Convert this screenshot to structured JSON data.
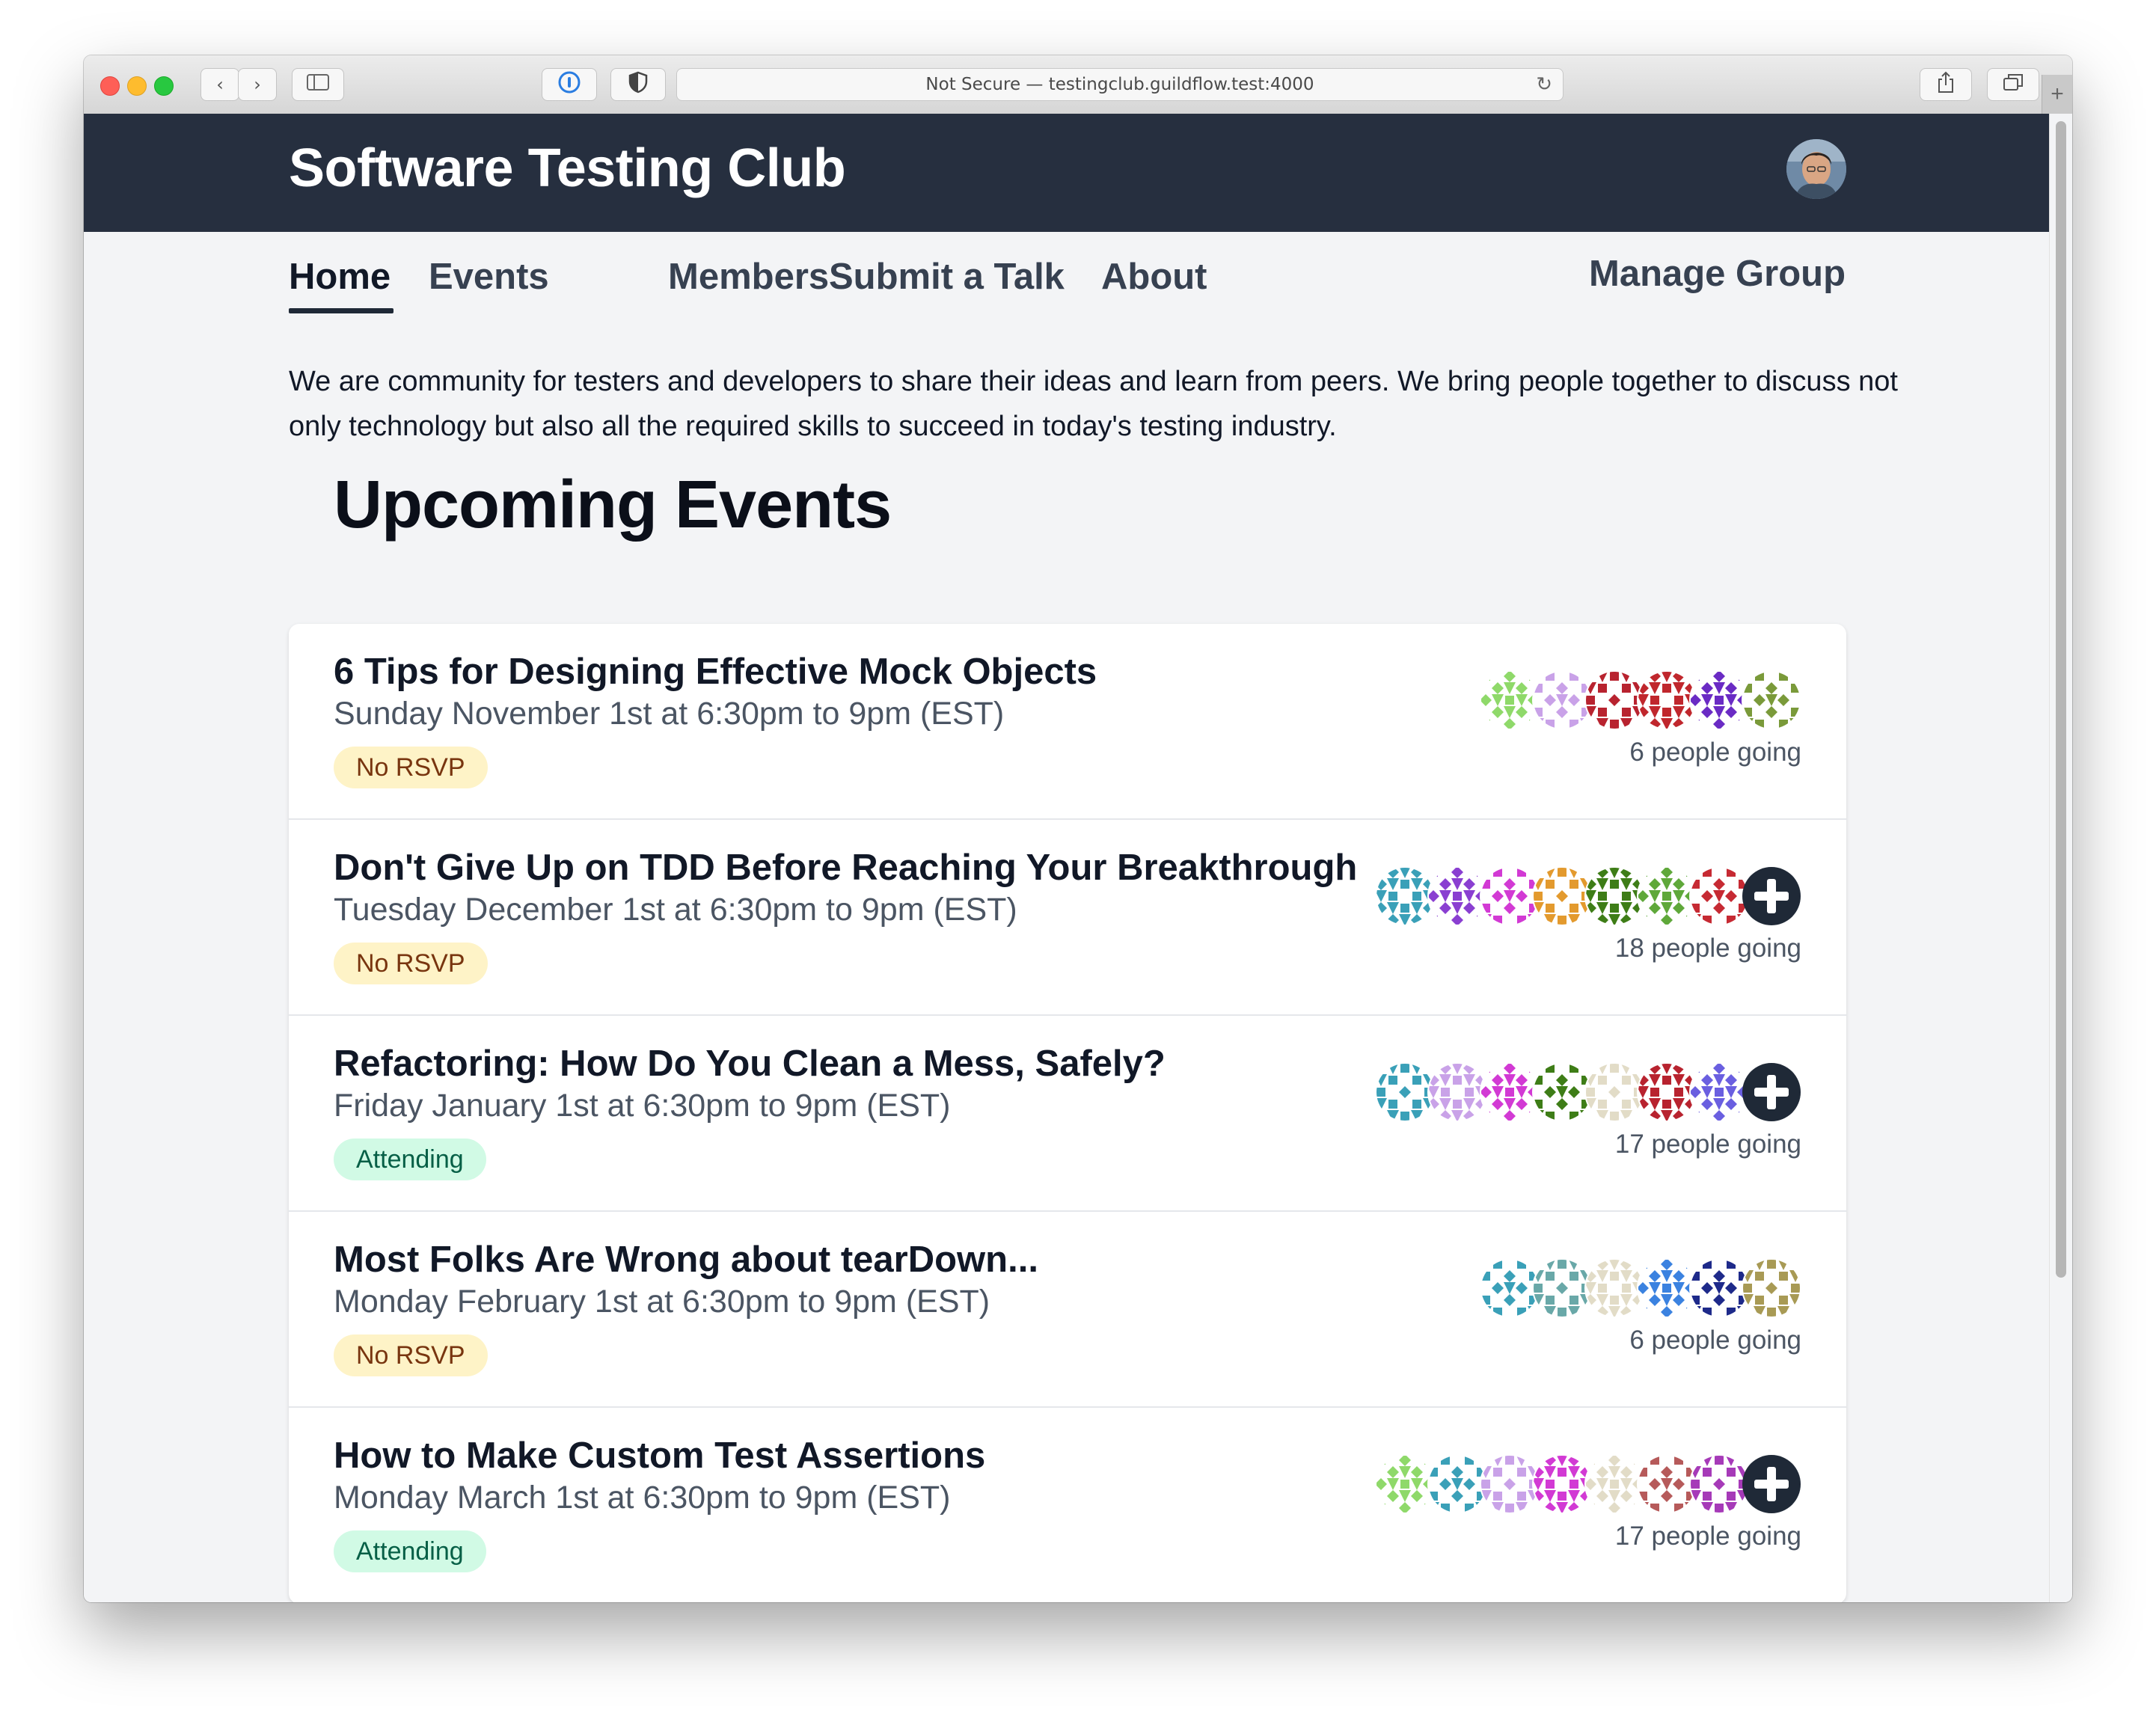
{
  "browser": {
    "address": "Not Secure — testingclub.guildflow.test:4000"
  },
  "site": {
    "title": "Software Testing Club"
  },
  "nav": {
    "items": [
      {
        "label": "Home",
        "active": true
      },
      {
        "label": "Events",
        "active": false
      },
      {
        "label": "Members",
        "active": false
      },
      {
        "label": "Submit a Talk",
        "active": false
      },
      {
        "label": "About",
        "active": false
      }
    ],
    "manage": "Manage Group"
  },
  "intro": "We are community for testers and developers to share their ideas and learn from peers. We bring people together to discuss not only technology but also all the required skills to succeed in today's testing industry.",
  "upcoming_heading": "Upcoming Events",
  "events": [
    {
      "title": "6 Tips for Designing Effective Mock Objects",
      "date": "Sunday November 1st at 6:30pm to 9pm (EST)",
      "status": "No RSVP",
      "going": "6 people going",
      "avatar_colors": [
        "#8fd96a",
        "#c9a2e8",
        "#b8232f",
        "#c0272d",
        "#6a2bc4",
        "#7a9a3a"
      ],
      "has_more": false
    },
    {
      "title": "Don't Give Up on TDD Before Reaching Your Breakthrough",
      "date": "Tuesday December 1st at 6:30pm to 9pm (EST)",
      "status": "No RSVP",
      "going": "18 people going",
      "avatar_colors": [
        "#3aa0b8",
        "#8a3fd1",
        "#d23ad4",
        "#e39a2e",
        "#3e7d17",
        "#5fa83a",
        "#c62a33"
      ],
      "has_more": true
    },
    {
      "title": "Refactoring: How Do You Clean a Mess, Safely?",
      "date": "Friday January 1st at 6:30pm to 9pm (EST)",
      "status": "Attending",
      "going": "17 people going",
      "avatar_colors": [
        "#3aa0b8",
        "#c9a2e8",
        "#d23ad4",
        "#3e7d17",
        "#e2dcc7",
        "#b8232f",
        "#6a5fe0"
      ],
      "has_more": true
    },
    {
      "title": "Most Folks Are Wrong about tearDown...",
      "date": "Monday February 1st at 6:30pm to 9pm (EST)",
      "status": "No RSVP",
      "going": "6 people going",
      "avatar_colors": [
        "#3aa0b8",
        "#69a8a8",
        "#e2dcc7",
        "#3b82e0",
        "#1e2a8a",
        "#a89a55"
      ],
      "has_more": false
    },
    {
      "title": "How to Make Custom Test Assertions",
      "date": "Monday March 1st at 6:30pm to 9pm (EST)",
      "status": "Attending",
      "going": "17 people going",
      "avatar_colors": [
        "#8fd96a",
        "#3aa0b8",
        "#c9a2e8",
        "#d23ad4",
        "#e2dcc7",
        "#b65a5a",
        "#a63ab8"
      ],
      "has_more": true
    }
  ],
  "colors": {
    "header_bg": "#262f3f",
    "page_bg": "#f3f4f6",
    "no_rsvp_bg": "#fef3c7",
    "attending_bg": "#d1fae5"
  }
}
